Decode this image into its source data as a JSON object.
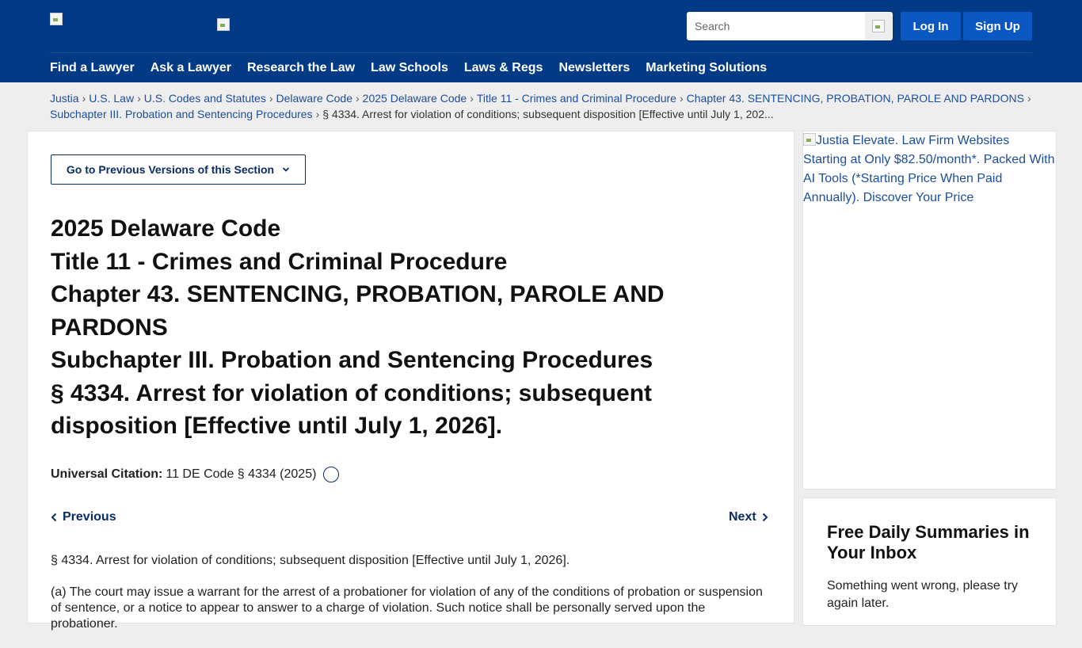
{
  "header": {
    "search_placeholder": "Search",
    "login_label": "Log In",
    "signup_label": "Sign Up",
    "nav": [
      {
        "label": "Find a Lawyer"
      },
      {
        "label": "Ask a Lawyer"
      },
      {
        "label": "Research the Law"
      },
      {
        "label": "Law Schools"
      },
      {
        "label": "Laws & Regs"
      },
      {
        "label": "Newsletters"
      },
      {
        "label": "Marketing Solutions"
      }
    ]
  },
  "breadcrumb": {
    "items": [
      "Justia",
      "U.S. Law",
      "U.S. Codes and Statutes",
      "Delaware Code",
      "2025 Delaware Code",
      "Title 11 - Crimes and Criminal Procedure",
      "Chapter 43. SENTENCING, PROBATION, PAROLE AND PARDONS",
      "Subchapter III. Probation and Sentencing Procedures"
    ],
    "current": "§ 4334. Arrest for violation of conditions; subsequent disposition [Effective until July 1, 202..."
  },
  "main": {
    "prev_versions_label": "Go to Previous Versions of this Section",
    "title_lines": [
      "2025 Delaware Code",
      "Title 11 - Crimes and Criminal Procedure",
      "Chapter 43. SENTENCING, PROBATION, PAROLE AND PARDONS",
      "Subchapter III. Probation and Sentencing Procedures",
      "§ 4334. Arrest for violation of conditions; subsequent disposition [Effective until July 1, 2026]."
    ],
    "citation_label": "Universal Citation:",
    "citation_value": "11 DE Code § 4334 (2025)",
    "previous_label": "Previous",
    "next_label": "Next",
    "paragraphs": [
      "§ 4334. Arrest for violation of conditions; subsequent disposition [Effective until July 1, 2026].",
      "(a) The court may issue a warrant for the arrest of a probationer for violation of any of the conditions of probation or suspension of sentence, or a notice to appear to answer to a charge of violation. Such notice shall be personally served upon the probationer."
    ]
  },
  "sidebar": {
    "ad_alt": "Justia Elevate. Law Firm Websites Starting at Only $82.50/month*. Packed With AI Tools (*Starting Price When Paid Annually). Discover Your Price",
    "newsletter_title": "Free Daily Summaries in Your Inbox",
    "newsletter_message": "Something went wrong, please try again later."
  },
  "colors": {
    "header_bg": "#023a85",
    "auth_button_bg": "#0a57c2",
    "link": "#1c4e9c",
    "page_bg": "#eeeeee"
  }
}
